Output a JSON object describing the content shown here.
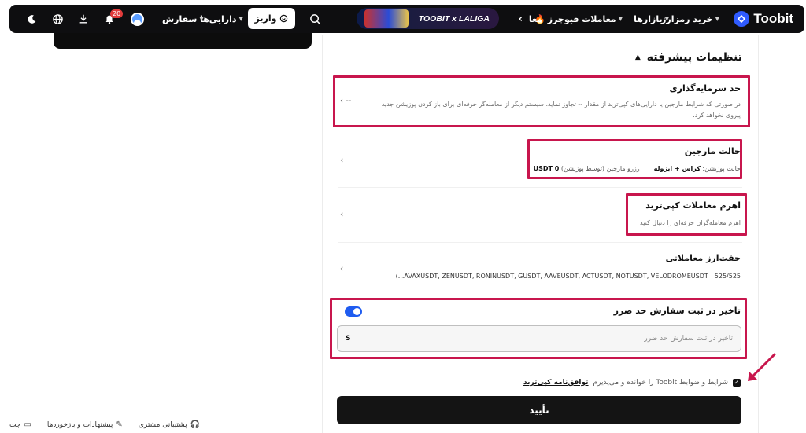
{
  "nav": {
    "logo": "Toobit",
    "buy_crypto": "خرید رمزارز",
    "markets": "بازارها",
    "futures": "معاملات فیوچرز",
    "more": "معا",
    "banner": "TOOBIT x LALIGA",
    "deposit": "واریز",
    "assets": "دارایی‌ها",
    "orders": "سفارش",
    "notif_count": "20",
    "icons": [
      "search-icon",
      "user-avatar",
      "bell-icon",
      "download-icon",
      "globe-icon",
      "moon-icon"
    ]
  },
  "panel": {
    "section_title": "تنظیمات پیشرفته",
    "investment_limit": {
      "title": "حد سرمایه‌گذاری",
      "value": "--",
      "desc": "در صورتی که شرایط مارجین یا دارایی‌های کپی‌ترید از مقدار -- تجاوز نماید، سیستم دیگر از معامله‌گر حرفه‌ای برای باز کردن پوزیشن جدید پیروی نخواهد کرد."
    },
    "margin_mode": {
      "title": "حالت مارجین",
      "position_mode_label": "حالت پوزیشن:",
      "position_mode_value": "کراس + ایزوله",
      "reserve_label": "رزرو مارجین (توسط پوزیشن)",
      "reserve_value": "USDT 0"
    },
    "leverage": {
      "title": "اهرم معاملات کپی‌ترید",
      "desc": "اهرم معامله‌گران حرفه‌ای را دنبال کنید"
    },
    "pairs": {
      "title": "جفت‌ارز معاملاتی",
      "count": "525/525",
      "list": "(...AVAXUSDT, ZENUSDT, RONINUSDT, GUSDT, AAVEUSDT, ACTUSDT, NOTUSDT, VELODROMEUSDT"
    },
    "stop_delay": {
      "title": "تاخیر در ثبت سفارش حد ضرر",
      "enabled": true,
      "placeholder": "تاخیر در ثبت سفارش حد ضرر",
      "unit": "S"
    },
    "terms": {
      "text": "شرایط و ضوابط Toobit را خوانده و می‌پذیرم",
      "link": "توافق‌نامه کپی‌ترید",
      "checked": true
    },
    "confirm": "تأیید"
  },
  "footer": {
    "support": "پشتیبانی مشتری",
    "feedback": "پیشنهادات و بازخوردها",
    "chat": "چت"
  },
  "colors": {
    "highlight": "#c8164d",
    "toggle": "#1f5cf0",
    "nav_bg": "#0e0e10",
    "button_bg": "#141414"
  }
}
